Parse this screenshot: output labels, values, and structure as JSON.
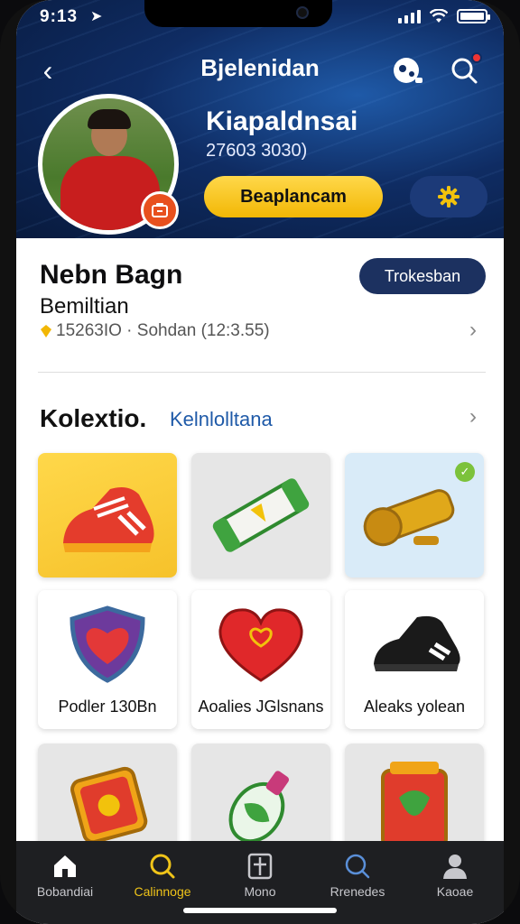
{
  "status_bar": {
    "time": "9:13"
  },
  "header": {
    "title": "Bjelenidan"
  },
  "profile": {
    "name": "Kiapaldnsai",
    "stats": "27603 3030)",
    "primary_button": "Beaplancam"
  },
  "info": {
    "title": "Nebn Bagn",
    "subtitle": "Bemiltian",
    "meta": "15263IO · Sohdan (12:3.55)",
    "action_button": "Trokesban"
  },
  "collection": {
    "title": "Kolextio.",
    "link": "Kelnlolltana"
  },
  "items": [
    {
      "label": "",
      "icon": "sneaker-icon",
      "bg": "yellow"
    },
    {
      "label": "",
      "icon": "scroll-icon",
      "bg": "grey"
    },
    {
      "label": "",
      "icon": "cannon-icon",
      "bg": "lightblue"
    },
    {
      "label": "Podler 130Bn",
      "icon": "heart-shield-icon",
      "bg": "white"
    },
    {
      "label": "Aoalies JGlsnans",
      "icon": "heart-icon",
      "bg": "white"
    },
    {
      "label": "Aleaks yolean",
      "icon": "shoe-icon",
      "bg": "white"
    },
    {
      "label": "",
      "icon": "badge-icon",
      "bg": "grey"
    },
    {
      "label": "",
      "icon": "potion-icon",
      "bg": "grey"
    },
    {
      "label": "",
      "icon": "box-icon",
      "bg": "grey"
    }
  ],
  "tabs": [
    {
      "label": "Bobandiai",
      "icon": "home-icon",
      "active": false
    },
    {
      "label": "Calinnoge",
      "icon": "search-icon",
      "active": true
    },
    {
      "label": "Mono",
      "icon": "book-icon",
      "active": false
    },
    {
      "label": "Rrenedes",
      "icon": "search-icon",
      "active": false
    },
    {
      "label": "Kaoae",
      "icon": "person-icon",
      "active": false
    }
  ],
  "colors": {
    "accent": "#f2b705",
    "header_blue": "#0f2c63",
    "tabbar": "#1e1f22"
  }
}
